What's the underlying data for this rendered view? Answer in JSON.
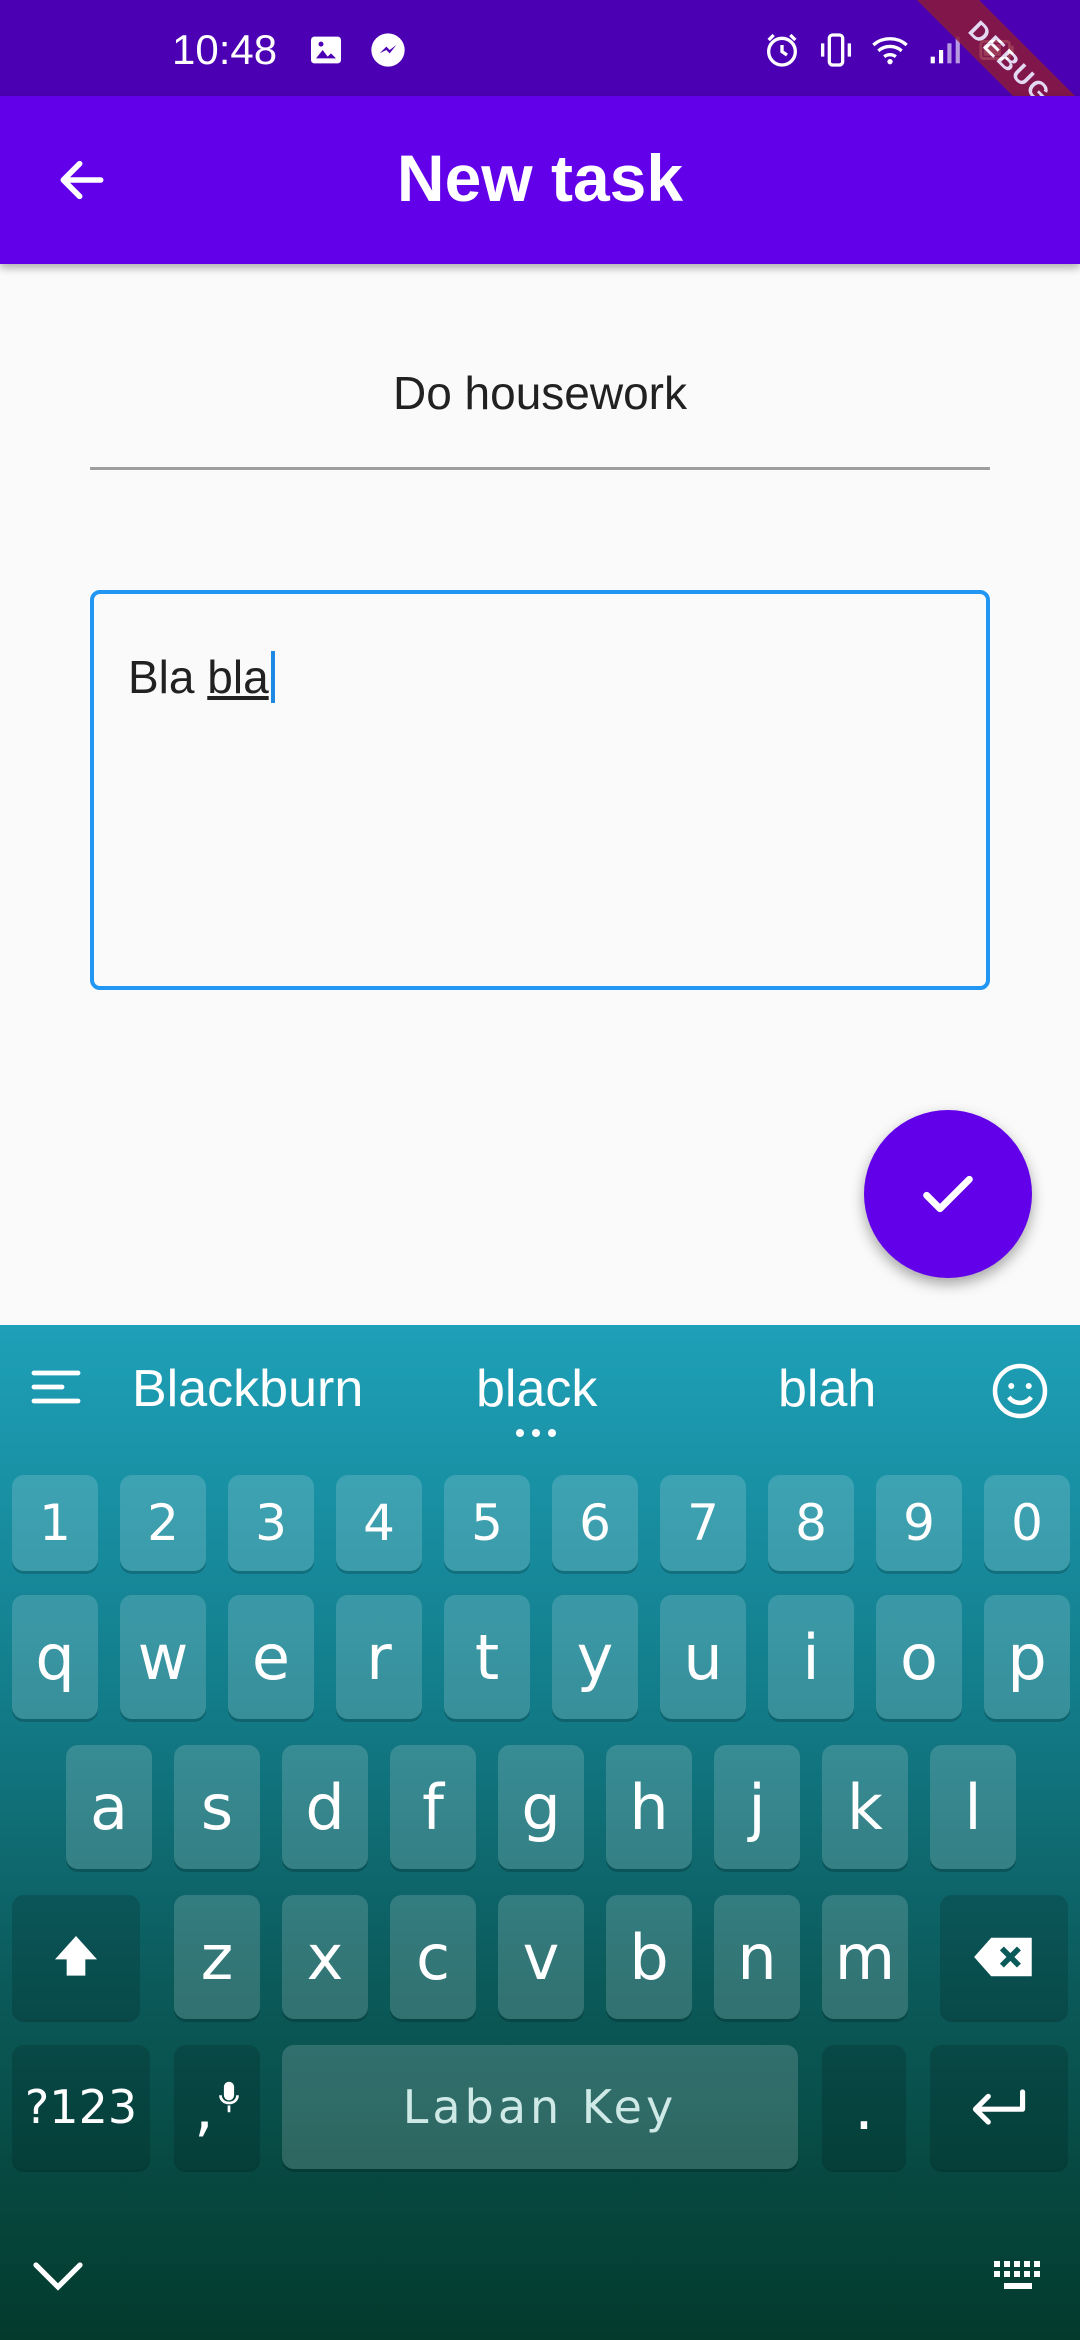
{
  "status_bar": {
    "time": "10:48",
    "icons": [
      "image-icon",
      "messenger-icon",
      "alarm-icon",
      "vibrate-icon",
      "wifi-icon",
      "signal-icon",
      "battery-icon"
    ],
    "debug_banner": "DEBUG"
  },
  "app_bar": {
    "title": "New task",
    "bg_color": "#6200ea"
  },
  "form": {
    "title_value": "Do housework",
    "description_plain": "Bla ",
    "description_composing": "bla",
    "focus_color": "#2196f3"
  },
  "fab": {
    "icon": "check-icon"
  },
  "keyboard": {
    "suggestions": [
      "Blackburn",
      "black",
      "blah"
    ],
    "number_row": [
      "1",
      "2",
      "3",
      "4",
      "5",
      "6",
      "7",
      "8",
      "9",
      "0"
    ],
    "row1": [
      "q",
      "w",
      "e",
      "r",
      "t",
      "y",
      "u",
      "i",
      "o",
      "p"
    ],
    "row2": [
      "a",
      "s",
      "d",
      "f",
      "g",
      "h",
      "j",
      "k",
      "l"
    ],
    "row3": [
      "z",
      "x",
      "c",
      "v",
      "b",
      "n",
      "m"
    ],
    "symbols_label": "?123",
    "comma_label": ",",
    "space_label": "Laban Key",
    "period_label": "."
  }
}
